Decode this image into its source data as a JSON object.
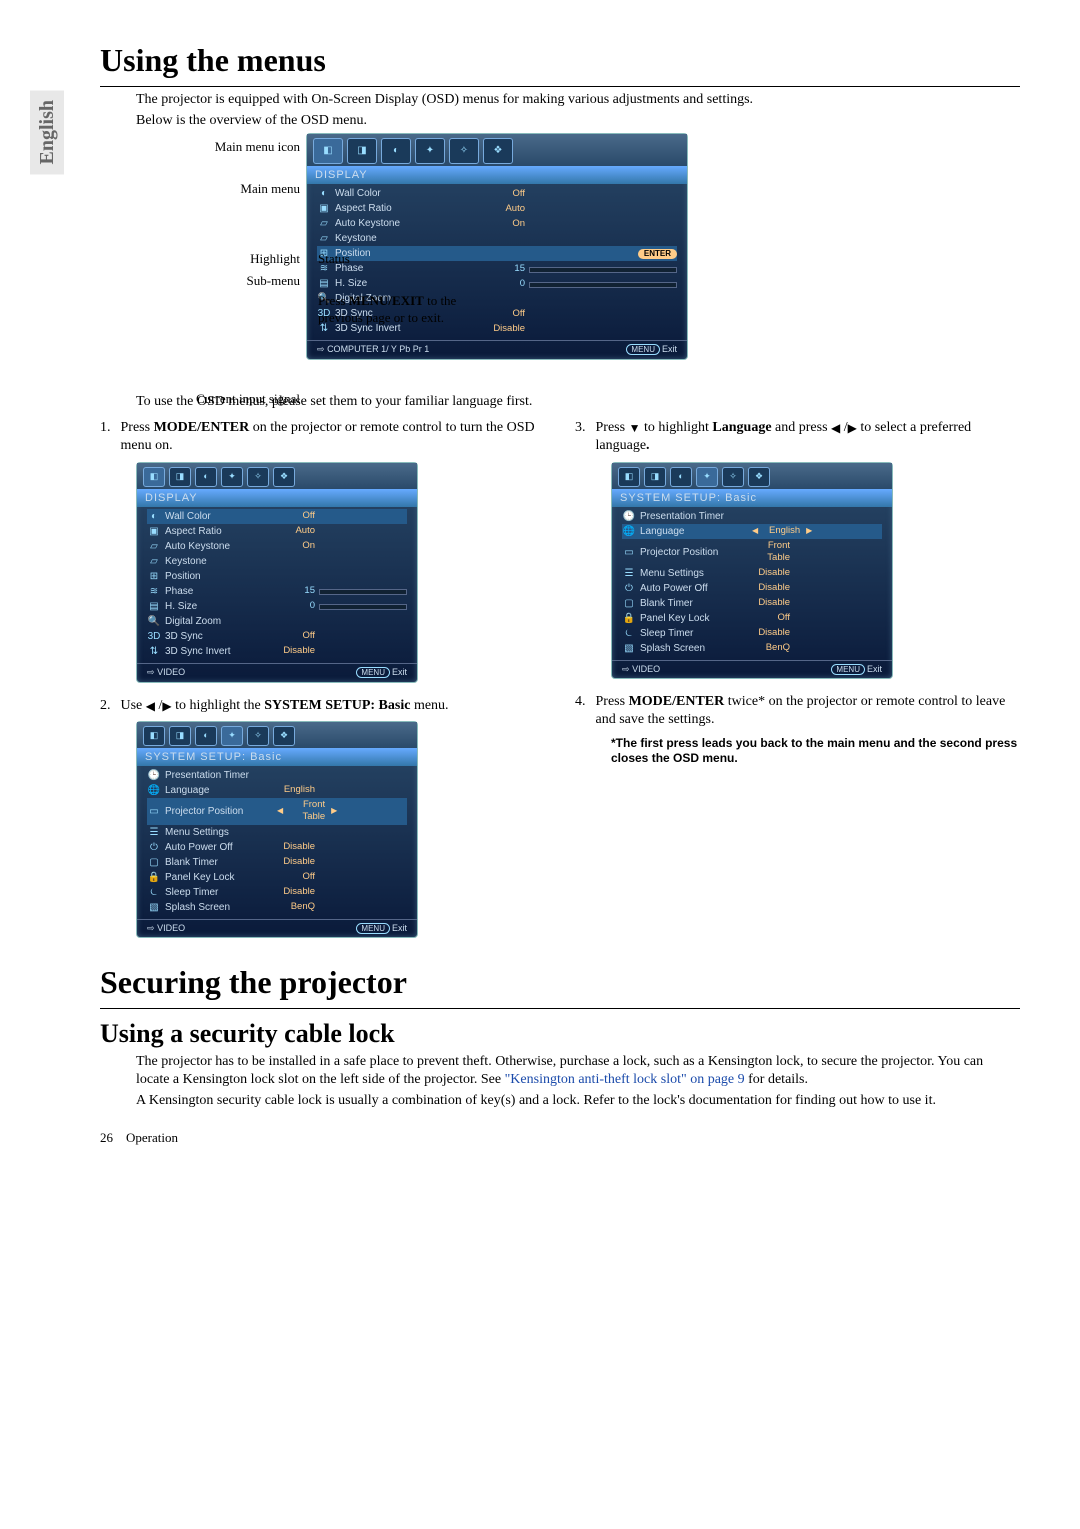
{
  "sidebar_lang": "English",
  "h1_menus": "Using the menus",
  "intro1": "The projector is equipped with On-Screen Display (OSD) menus for making various adjustments and settings.",
  "intro2": "Below is the overview of the OSD menu.",
  "diag_labels": {
    "main_menu_icon": "Main menu icon",
    "main_menu": "Main menu",
    "highlight": "Highlight",
    "sub_menu": "Sub-menu",
    "current_input": "Current input signal",
    "status": "Status",
    "press_menu_exit": "Press MENU/EXIT to the previous page or to exit."
  },
  "osd_main": {
    "title": "DISPLAY",
    "rows": [
      {
        "icon": "◐",
        "label": "Wall Color",
        "val": "Off"
      },
      {
        "icon": "▣",
        "label": "Aspect Ratio",
        "val": "Auto"
      },
      {
        "icon": "▱",
        "label": "Auto Keystone",
        "val": "On"
      },
      {
        "icon": "▱",
        "label": "Keystone",
        "val": ""
      },
      {
        "icon": "⊞",
        "label": "Position",
        "enter": true,
        "hl": true
      },
      {
        "icon": "≋",
        "label": "Phase",
        "num": "15",
        "slider": 50
      },
      {
        "icon": "▤",
        "label": "H. Size",
        "num": "0",
        "slider": 5
      },
      {
        "icon": "🔍",
        "label": "Digital Zoom",
        "val": ""
      },
      {
        "icon": "3D",
        "label": "3D Sync",
        "val": "Off"
      },
      {
        "icon": "⇅",
        "label": "3D Sync Invert",
        "val": "Disable"
      }
    ],
    "footer_left_icon": "⇨",
    "footer_left": "COMPUTER 1/ Y Pb Pr 1",
    "footer_right_btn": "MENU",
    "footer_right": "Exit"
  },
  "after_diag": "To use the OSD menus, please set them to your familiar language first.",
  "step1_num": "1.",
  "step1_text_a": "Press ",
  "step1_text_b": "MODE/ENTER",
  "step1_text_c": " on the projector or remote control to turn the OSD menu on.",
  "osd_small1": {
    "title": "DISPLAY",
    "rows": [
      {
        "icon": "◐",
        "label": "Wall Color",
        "val": "Off",
        "hl": true
      },
      {
        "icon": "▣",
        "label": "Aspect Ratio",
        "val": "Auto"
      },
      {
        "icon": "▱",
        "label": "Auto Keystone",
        "val": "On"
      },
      {
        "icon": "▱",
        "label": "Keystone",
        "val": ""
      },
      {
        "icon": "⊞",
        "label": "Position",
        "val": ""
      },
      {
        "icon": "≋",
        "label": "Phase",
        "num": "15",
        "slider": 50
      },
      {
        "icon": "▤",
        "label": "H. Size",
        "num": "0",
        "slider": 5
      },
      {
        "icon": "🔍",
        "label": "Digital Zoom",
        "val": ""
      },
      {
        "icon": "3D",
        "label": "3D Sync",
        "val": "Off"
      },
      {
        "icon": "⇅",
        "label": "3D Sync Invert",
        "val": "Disable"
      }
    ],
    "footer_left": "VIDEO",
    "footer_right_btn": "MENU",
    "footer_right": "Exit"
  },
  "step2_num": "2.",
  "step2_text_a": "Use ",
  "step2_text_b": " to highlight the ",
  "step2_text_c": "SYSTEM SETUP: Basic",
  "step2_text_d": " menu.",
  "osd_small2": {
    "title": "SYSTEM SETUP: Basic",
    "rows": [
      {
        "icon": "🕒",
        "label": "Presentation Timer",
        "val": ""
      },
      {
        "icon": "🌐",
        "label": "Language",
        "val": "English"
      },
      {
        "icon": "▭",
        "label": "Projector Position",
        "val": "Front Table",
        "hl": true,
        "arrows": true
      },
      {
        "icon": "☰",
        "label": "Menu Settings",
        "val": ""
      },
      {
        "icon": "⏻",
        "label": "Auto Power Off",
        "val": "Disable"
      },
      {
        "icon": "▢",
        "label": "Blank Timer",
        "val": "Disable"
      },
      {
        "icon": "🔒",
        "label": "Panel Key Lock",
        "val": "Off"
      },
      {
        "icon": "⏾",
        "label": "Sleep Timer",
        "val": "Disable"
      },
      {
        "icon": "▧",
        "label": "Splash Screen",
        "val": "BenQ"
      }
    ],
    "footer_left": "VIDEO",
    "footer_right_btn": "MENU",
    "footer_right": "Exit"
  },
  "step3_num": "3.",
  "step3_text_a": "Press ",
  "step3_text_b": " to highlight ",
  "step3_text_c": "Language",
  "step3_text_d": " and press ",
  "step3_text_e": " to select a preferred language",
  "step3_text_f": ".",
  "osd_small3": {
    "title": "SYSTEM SETUP: Basic",
    "rows": [
      {
        "icon": "🕒",
        "label": "Presentation Timer",
        "val": ""
      },
      {
        "icon": "🌐",
        "label": "Language",
        "val": "English",
        "hl": true,
        "arrows": true
      },
      {
        "icon": "▭",
        "label": "Projector Position",
        "val": "Front Table"
      },
      {
        "icon": "☰",
        "label": "Menu Settings",
        "val": "Disable"
      },
      {
        "icon": "⏻",
        "label": "Auto Power Off",
        "val": "Disable"
      },
      {
        "icon": "▢",
        "label": "Blank Timer",
        "val": "Disable"
      },
      {
        "icon": "🔒",
        "label": "Panel Key Lock",
        "val": "Off"
      },
      {
        "icon": "⏾",
        "label": "Sleep Timer",
        "val": "Disable"
      },
      {
        "icon": "▧",
        "label": "Splash Screen",
        "val": "BenQ"
      }
    ],
    "footer_left": "VIDEO",
    "footer_right_btn": "MENU",
    "footer_right": "Exit"
  },
  "step4_num": "4.",
  "step4_text_a": "Press ",
  "step4_text_b": "MODE/ENTER",
  "step4_text_c": " twice* on the projector or remote control to leave and save the settings.",
  "step4_note": "*The first press leads you back to the main menu and the second press closes the OSD menu.",
  "h1_secure": "Securing the projector",
  "h2_cable": "Using a security cable lock",
  "secure_p1_a": "The projector has to be installed in a safe place to prevent theft. Otherwise, purchase a lock, such as a Kensington lock, to secure the projector. You can locate a Kensington lock slot on the left side of the projector. See ",
  "secure_link": "\"Kensington anti-theft lock slot\" on page 9",
  "secure_p1_b": " for details.",
  "secure_p2": "A Kensington security cable lock is usually a combination of key(s) and a lock. Refer to the lock's documentation for finding out how to use it.",
  "page_num": "26",
  "page_section": "Operation"
}
